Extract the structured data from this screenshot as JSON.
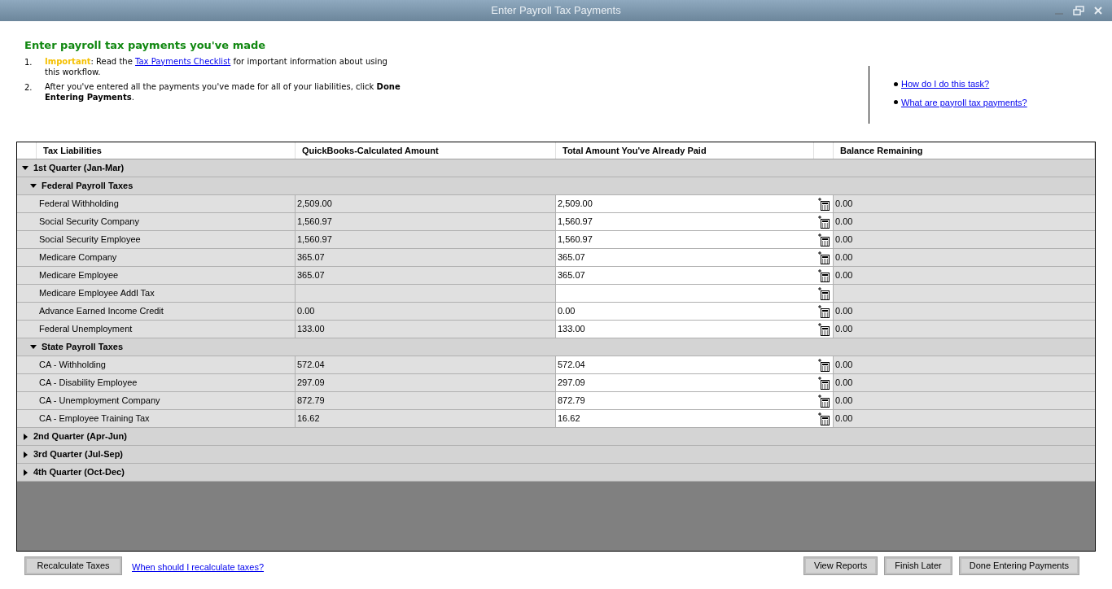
{
  "window": {
    "title": "Enter Payroll Tax Payments"
  },
  "heading": "Enter payroll tax payments you've made",
  "steps": [
    {
      "number": "1.",
      "parts": [
        {
          "kind": "highlight",
          "text": "Important"
        },
        {
          "kind": "text",
          "text": ": Read the "
        },
        {
          "kind": "link",
          "text": "Tax Payments Checklist"
        },
        {
          "kind": "text",
          "text": " for important information about using this workflow."
        }
      ]
    },
    {
      "number": "2.",
      "parts": [
        {
          "kind": "text",
          "text": "After you've entered all the payments you've made for all of your liabilities, click "
        },
        {
          "kind": "bold",
          "text": "Done Entering Payments"
        },
        {
          "kind": "text",
          "text": "."
        }
      ]
    }
  ],
  "help_links": [
    "How do I do this task?",
    "What are payroll tax payments?"
  ],
  "table": {
    "columns": [
      "Tax Liabilities",
      "QuickBooks-Calculated Amount",
      "Total Amount You've Already Paid",
      "Balance Remaining"
    ],
    "quarters": [
      {
        "label": "1st Quarter (Jan-Mar)",
        "expanded": true,
        "groups": [
          {
            "label": "Federal Payroll Taxes",
            "expanded": true,
            "rows": [
              {
                "name": "Federal Withholding",
                "calculated": "2,509.00",
                "paid": "2,509.00",
                "balance": "0.00"
              },
              {
                "name": "Social Security Company",
                "calculated": "1,560.97",
                "paid": "1,560.97",
                "balance": "0.00"
              },
              {
                "name": "Social Security Employee",
                "calculated": "1,560.97",
                "paid": "1,560.97",
                "balance": "0.00"
              },
              {
                "name": "Medicare Company",
                "calculated": "365.07",
                "paid": "365.07",
                "balance": "0.00"
              },
              {
                "name": "Medicare Employee",
                "calculated": "365.07",
                "paid": "365.07",
                "balance": "0.00"
              },
              {
                "name": "Medicare Employee Addl Tax"
              },
              {
                "name": "Advance Earned Income Credit",
                "calculated": "0.00",
                "paid": "0.00",
                "balance": "0.00"
              },
              {
                "name": "Federal Unemployment",
                "calculated": "133.00",
                "paid": "133.00",
                "balance": "0.00"
              }
            ]
          },
          {
            "label": "State Payroll Taxes",
            "expanded": true,
            "rows": [
              {
                "name": "CA - Withholding",
                "calculated": "572.04",
                "paid": "572.04",
                "balance": "0.00"
              },
              {
                "name": "CA - Disability Employee",
                "calculated": "297.09",
                "paid": "297.09",
                "balance": "0.00"
              },
              {
                "name": "CA - Unemployment Company",
                "calculated": "872.79",
                "paid": "872.79",
                "balance": "0.00"
              },
              {
                "name": "CA - Employee Training Tax",
                "calculated": "16.62",
                "paid": "16.62",
                "balance": "0.00"
              }
            ]
          }
        ]
      },
      {
        "label": "2nd Quarter (Apr-Jun)",
        "expanded": false
      },
      {
        "label": "3rd Quarter (Jul-Sep)",
        "expanded": false
      },
      {
        "label": "4th Quarter (Oct-Dec)",
        "expanded": false
      }
    ]
  },
  "footer": {
    "left_button": "Recalculate Taxes",
    "link": "When should I recalculate taxes?",
    "right_buttons": [
      "View Reports",
      "Finish Later",
      "Done Entering Payments"
    ]
  }
}
